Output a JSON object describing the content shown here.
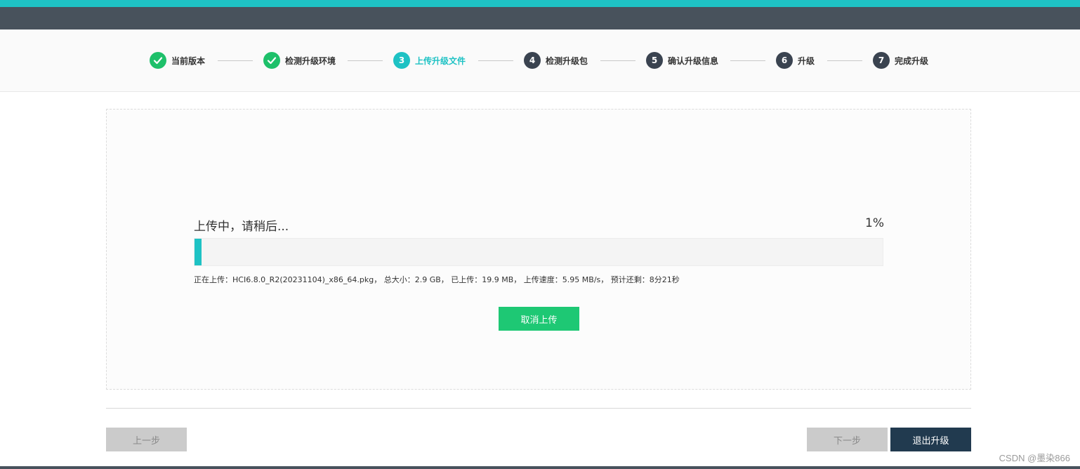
{
  "steps": [
    {
      "number": "1",
      "label": "当前版本",
      "state": "done",
      "icon": "check-icon"
    },
    {
      "number": "2",
      "label": "检测升级环境",
      "state": "done",
      "icon": "check-icon"
    },
    {
      "number": "3",
      "label": "上传升级文件",
      "state": "active"
    },
    {
      "number": "4",
      "label": "检测升级包",
      "state": "pending"
    },
    {
      "number": "5",
      "label": "确认升级信息",
      "state": "pending"
    },
    {
      "number": "6",
      "label": "升级",
      "state": "pending"
    },
    {
      "number": "7",
      "label": "完成升级",
      "state": "pending"
    }
  ],
  "upload": {
    "status": "上传中，请稍后...",
    "percent_label": "1%",
    "progress": 0.01,
    "details": "正在上传：HCI6.8.0_R2(20231104)_x86_64.pkg，  总大小：2.9 GB，  已上传：19.9 MB，  上传速度：5.95 MB/s，  预计还剩：8分21秒",
    "cancel_label": "取消上传"
  },
  "footer": {
    "prev_label": "上一步",
    "next_label": "下一步",
    "exit_label": "退出升级"
  },
  "watermark": "CSDN @墨染866",
  "colors": {
    "accent": "#1ec2c4",
    "success": "#1ec06a",
    "header": "#48525c",
    "primary_dark": "#213a4f"
  }
}
